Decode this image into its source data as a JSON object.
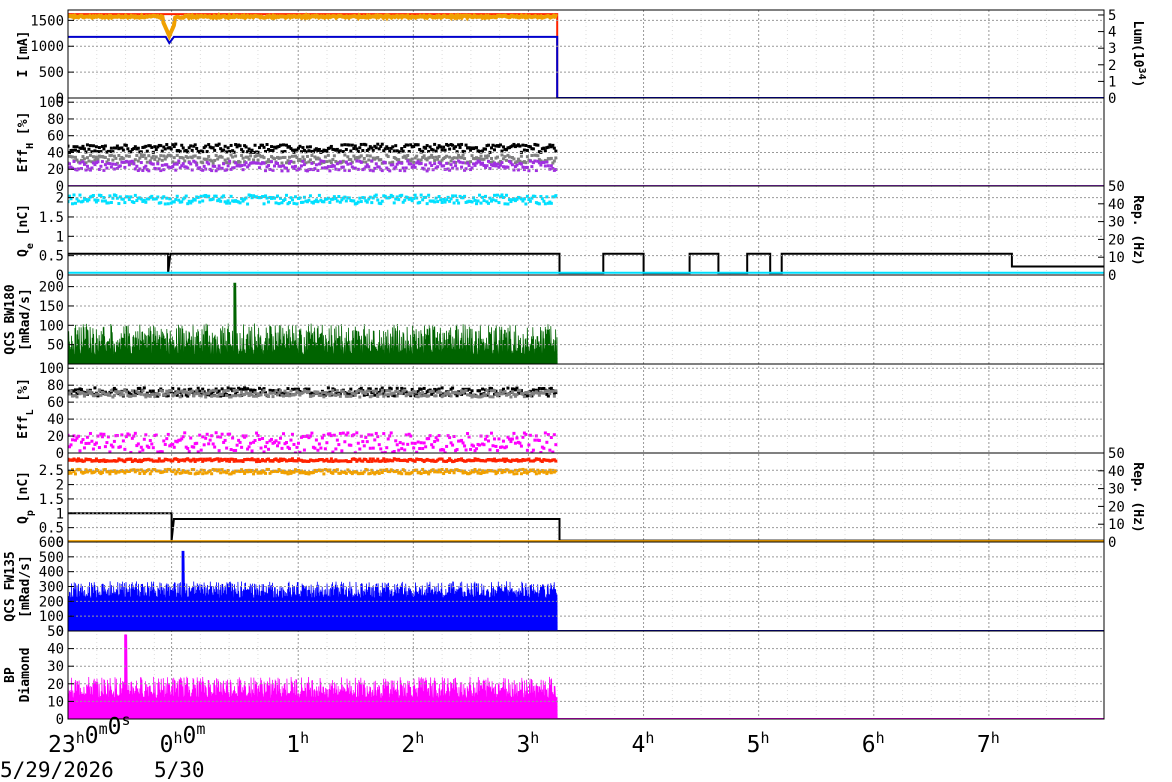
{
  "chart_data": {
    "type": "line",
    "x_axis": {
      "range_hours": [
        -1,
        8
      ],
      "ticks": [
        {
          "t": -1,
          "parts": [
            [
              "23",
              "h"
            ],
            [
              "0",
              "m"
            ],
            [
              "0",
              "s"
            ]
          ]
        },
        {
          "t": -0.1,
          "parts": [
            [
              "0",
              "h"
            ],
            [
              "0",
              "m"
            ]
          ]
        },
        {
          "t": 1,
          "parts": [
            [
              "1",
              "h"
            ]
          ]
        },
        {
          "t": 2,
          "parts": [
            [
              "2",
              "h"
            ]
          ]
        },
        {
          "t": 3,
          "parts": [
            [
              "3",
              "h"
            ]
          ]
        },
        {
          "t": 4,
          "parts": [
            [
              "4",
              "h"
            ]
          ]
        },
        {
          "t": 5,
          "parts": [
            [
              "5",
              "h"
            ]
          ]
        },
        {
          "t": 6,
          "parts": [
            [
              "6",
              "h"
            ]
          ]
        },
        {
          "t": 7,
          "parts": [
            [
              "7",
              "h"
            ]
          ]
        }
      ],
      "dates": [
        "5/29/2026",
        "5/30"
      ]
    },
    "panels": [
      {
        "id": "current",
        "ylabel_parts": [
          [
            "I [mA]",
            ""
          ]
        ],
        "ylim": [
          0,
          1700
        ],
        "yticks": [
          0,
          500,
          1000,
          1500
        ],
        "right_ylabel_parts": [
          [
            "Lum(10",
            ""
          ],
          [
            "34",
            "sup"
          ],
          [
            ")",
            ""
          ]
        ],
        "right_ylim": [
          0,
          5.3
        ],
        "right_yticks": [
          0,
          1,
          2,
          3,
          4,
          5
        ],
        "series": [
          {
            "kind": "line",
            "color": "#ff2200",
            "points": [
              [
                -1,
                1620
              ],
              [
                3.25,
                1620
              ],
              [
                3.25,
                0
              ],
              [
                8,
                0
              ]
            ]
          },
          {
            "kind": "noise",
            "color": "#f0a000",
            "base": 1570,
            "amp": 40,
            "end": 3.25,
            "dip_at": -0.12,
            "dip_to": 1200
          },
          {
            "kind": "line",
            "color": "#0000cc",
            "points": [
              [
                -1,
                1180
              ],
              [
                -0.15,
                1180
              ],
              [
                -0.12,
                1060
              ],
              [
                -0.08,
                1180
              ],
              [
                3.25,
                1180
              ],
              [
                3.25,
                0
              ],
              [
                8,
                0
              ]
            ]
          }
        ]
      },
      {
        "id": "eff-h",
        "ylabel_parts": [
          [
            "Eff",
            ""
          ],
          [
            "H",
            "sub"
          ],
          [
            " [%]",
            ""
          ]
        ],
        "ylim": [
          0,
          105
        ],
        "yticks": [
          0,
          20,
          40,
          60,
          80,
          100
        ],
        "series": [
          {
            "kind": "dots",
            "color": "#000000",
            "base": 45,
            "amp": 5,
            "end": 3.25
          },
          {
            "kind": "dots",
            "color": "#808080",
            "base": 32,
            "amp": 5,
            "end": 3.25
          },
          {
            "kind": "dots",
            "color": "#a030e0",
            "base": 24,
            "amp": 6,
            "end": 3.25
          },
          {
            "kind": "line",
            "color": "#a030e0",
            "points": [
              [
                -1,
                0
              ],
              [
                8,
                0
              ]
            ]
          }
        ]
      },
      {
        "id": "charge-e",
        "ylabel_parts": [
          [
            "Q",
            ""
          ],
          [
            "e",
            "sub"
          ],
          [
            " [nC]",
            ""
          ]
        ],
        "ylim": [
          0,
          2.3
        ],
        "yticks": [
          0,
          0.5,
          1,
          1.5,
          2
        ],
        "right_ylabel_parts": [
          [
            "Rep. (Hz)",
            ""
          ]
        ],
        "right_ylim": [
          0,
          50
        ],
        "right_yticks": [
          0,
          10,
          20,
          30,
          40,
          50
        ],
        "series": [
          {
            "kind": "dots",
            "color": "#00e0ff",
            "base": 1.95,
            "amp": 0.12,
            "end": 3.25
          },
          {
            "kind": "line",
            "color": "#000000",
            "points": [
              [
                -1,
                0.55
              ],
              [
                -0.13,
                0.55
              ],
              [
                -0.13,
                0.05
              ],
              [
                -0.11,
                0.55
              ],
              [
                3.27,
                0.55
              ],
              [
                3.27,
                0.05
              ],
              [
                3.65,
                0.05
              ],
              [
                3.65,
                0.55
              ],
              [
                4.0,
                0.55
              ],
              [
                4.0,
                0.05
              ],
              [
                4.4,
                0.05
              ],
              [
                4.4,
                0.55
              ],
              [
                4.65,
                0.55
              ],
              [
                4.65,
                0.05
              ],
              [
                4.9,
                0.05
              ],
              [
                4.9,
                0.55
              ],
              [
                5.1,
                0.55
              ],
              [
                5.1,
                0.05
              ],
              [
                5.2,
                0.05
              ],
              [
                5.2,
                0.55
              ],
              [
                7.2,
                0.55
              ],
              [
                7.2,
                0.22
              ],
              [
                8,
                0.22
              ]
            ]
          },
          {
            "kind": "line",
            "color": "#00e0ff",
            "points": [
              [
                -1,
                0.06
              ],
              [
                8,
                0.06
              ]
            ]
          }
        ]
      },
      {
        "id": "qcs-bw180",
        "ylabel_parts": [
          [
            "QCS BW180",
            ""
          ],
          [
            "[mRad/s]",
            ""
          ]
        ],
        "ylim": [
          0,
          230
        ],
        "yticks": [
          50,
          100,
          150,
          200
        ],
        "series": [
          {
            "kind": "fill",
            "color": "#006400",
            "base": 25,
            "amp": 80,
            "end": 3.25,
            "spike_at": 0.45,
            "spike_to": 210
          }
        ]
      },
      {
        "id": "eff-l",
        "ylabel_parts": [
          [
            "Eff",
            ""
          ],
          [
            "L",
            "sub"
          ],
          [
            " [%]",
            ""
          ]
        ],
        "ylim": [
          0,
          105
        ],
        "yticks": [
          0,
          20,
          40,
          60,
          80,
          100
        ],
        "series": [
          {
            "kind": "dots",
            "color": "#000000",
            "base": 72,
            "amp": 5,
            "end": 3.25
          },
          {
            "kind": "dots",
            "color": "#808080",
            "base": 70,
            "amp": 4,
            "end": 3.25
          },
          {
            "kind": "dots",
            "color": "#ff00ff",
            "base": 12,
            "amp": 12,
            "end": 3.25
          }
        ]
      },
      {
        "id": "charge-p",
        "ylabel_parts": [
          [
            "Q",
            ""
          ],
          [
            "p",
            "sub"
          ],
          [
            " [nC]",
            ""
          ]
        ],
        "ylim": [
          0,
          3.1
        ],
        "yticks": [
          0,
          0.5,
          1,
          1.5,
          2,
          2.5
        ],
        "right_ylabel_parts": [
          [
            "Rep. (Hz)",
            ""
          ]
        ],
        "right_ylim": [
          0,
          50
        ],
        "right_yticks": [
          0,
          10,
          20,
          30,
          40,
          50
        ],
        "series": [
          {
            "kind": "dots",
            "color": "#ff2200",
            "base": 2.85,
            "amp": 0.05,
            "end": 3.25
          },
          {
            "kind": "dots",
            "color": "#f0a000",
            "base": 2.45,
            "amp": 0.08,
            "end": 3.25
          },
          {
            "kind": "line",
            "color": "#000000",
            "points": [
              [
                -1,
                1.0
              ],
              [
                -0.1,
                1.0
              ],
              [
                -0.1,
                0.05
              ],
              [
                -0.08,
                0.8
              ],
              [
                3.27,
                0.8
              ],
              [
                3.27,
                0.05
              ],
              [
                8,
                0.05
              ]
            ]
          },
          {
            "kind": "line",
            "color": "#f0a000",
            "points": [
              [
                -1,
                0.03
              ],
              [
                8,
                0.03
              ]
            ]
          }
        ]
      },
      {
        "id": "qcs-fw135",
        "ylabel_parts": [
          [
            "QCS FW135",
            ""
          ],
          [
            "[mRad/s]",
            ""
          ]
        ],
        "ylim": [
          0,
          600
        ],
        "yticks": [
          0,
          100,
          200,
          300,
          400,
          500,
          600
        ],
        "series": [
          {
            "kind": "fill",
            "color": "#0000ff",
            "base": 225,
            "amp": 110,
            "end": 3.25,
            "spike_at": 0.0,
            "spike_to": 540
          },
          {
            "kind": "line",
            "color": "#0000aa",
            "points": [
              [
                3.25,
                0
              ],
              [
                8,
                0
              ]
            ]
          }
        ]
      },
      {
        "id": "bp-diamond",
        "ylabel_parts": [
          [
            "BP",
            ""
          ],
          [
            "Diamond",
            ""
          ]
        ],
        "ylim": [
          0,
          50
        ],
        "yticks": [
          0,
          10,
          20,
          30,
          40,
          50
        ],
        "series": [
          {
            "kind": "fill",
            "color": "#ff00ff",
            "base": 12,
            "amp": 12,
            "end": 3.25,
            "spike_at": -0.5,
            "spike_to": 48
          },
          {
            "kind": "line",
            "color": "#ff00ff",
            "points": [
              [
                3.25,
                0
              ],
              [
                8,
                0
              ]
            ]
          }
        ]
      }
    ]
  }
}
